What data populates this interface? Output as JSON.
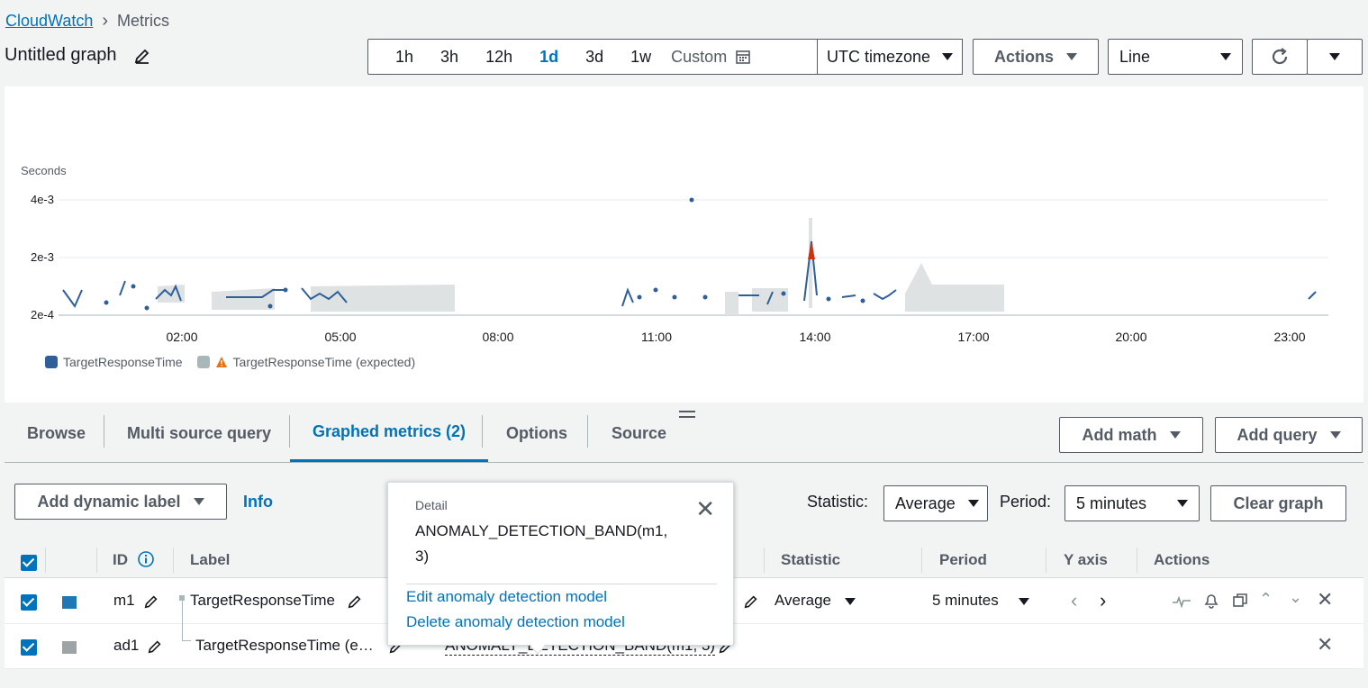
{
  "breadcrumb": {
    "root": "CloudWatch",
    "current": "Metrics"
  },
  "graph_title": "Untitled graph",
  "time_ranges": [
    "1h",
    "3h",
    "12h",
    "1d",
    "3d",
    "1w"
  ],
  "active_range": "1d",
  "custom_label": "Custom",
  "timezone": "UTC timezone",
  "actions_label": "Actions",
  "chart_type_select": "Line",
  "chart_data": {
    "type": "line",
    "ylabel": "Seconds",
    "y_ticks": [
      "4e-3",
      "2e-3",
      "2e-4"
    ],
    "x_ticks": [
      "02:00",
      "05:00",
      "08:00",
      "11:00",
      "14:00",
      "17:00",
      "20:00",
      "23:00"
    ],
    "series": [
      {
        "name": "TargetResponseTime",
        "color": "#2e5f99"
      },
      {
        "name": "TargetResponseTime (expected)",
        "color": "#c7cbcc",
        "warning": true
      }
    ],
    "anomaly_color": "#d13212"
  },
  "tabs": [
    "Browse",
    "Multi source query",
    "Graphed metrics (2)",
    "Options",
    "Source"
  ],
  "active_tab": "Graphed metrics (2)",
  "add_math_label": "Add math",
  "add_query_label": "Add query",
  "add_dynamic_label": "Add dynamic label",
  "info_label": "Info",
  "statistic_label": "Statistic:",
  "statistic_value": "Average",
  "period_label": "Period:",
  "period_value": "5 minutes",
  "clear_graph_label": "Clear graph",
  "table": {
    "headers": {
      "id": "ID",
      "label": "Label",
      "statistic": "Statistic",
      "period": "Period",
      "yaxis": "Y axis",
      "actions": "Actions"
    },
    "rows": [
      {
        "id": "m1",
        "label": "TargetResponseTime",
        "statistic": "Average",
        "period": "5 minutes",
        "color": "#1f77b4"
      },
      {
        "id": "ad1",
        "label": "TargetResponseTime (e…",
        "details": "ANOMALY_DETECTION_BAND(m1, 3)",
        "color": "#9ea4a6"
      }
    ]
  },
  "popover": {
    "detail_label": "Detail",
    "detail_value": "ANOMALY_DETECTION_BAND(m1, 3)",
    "edit_link": "Edit anomaly detection model",
    "delete_link": "Delete anomaly detection model"
  }
}
